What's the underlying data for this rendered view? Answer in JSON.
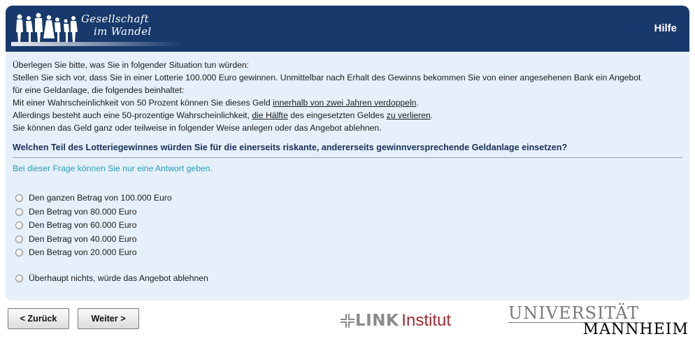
{
  "header": {
    "logo_line1": "Gesellschaft",
    "logo_line2": "im Wandel",
    "help_label": "Hilfe"
  },
  "intro": {
    "line1": "Überlegen Sie bitte, was Sie in folgender Situation tun würden:",
    "line2": "Stellen Sie sich vor, dass Sie in einer Lotterie 100.000 Euro gewinnen. Unmittelbar nach Erhalt des Gewinns bekommen Sie von einer angesehenen Bank ein Angebot",
    "line3": "für eine Geldanlage, die folgendes beinhaltet:",
    "line4_a": "Mit einer Wahrscheinlichkeit von 50 Prozent können Sie dieses Geld ",
    "line4_u": "innerhalb von zwei Jahren verdoppeln",
    "line4_b": ".",
    "line5_a": "Allerdings besteht auch eine 50-prozentige Wahrscheinlichkeit, ",
    "line5_u1": "die Hälfte",
    "line5_b": " des eingesetzten Geldes ",
    "line5_u2": "zu verlieren",
    "line5_c": ".",
    "line6": "Sie können das Geld ganz oder teilweise in folgender Weise anlegen oder das Angebot ablehnen."
  },
  "question": "Welchen Teil des Lotteriegewinnes würden Sie für die einerseits riskante, andererseits gewinnversprechende Geldanlage einsetzen?",
  "hint": "Bei dieser Frage können Sie nur eine Antwort geben.",
  "options": [
    "Den ganzen Betrag von 100.000 Euro",
    "Den Betrag von 80.000 Euro",
    "Den Betrag von 60.000 Euro",
    "Den Betrag von 40.000 Euro",
    "Den Betrag von 20.000 Euro",
    "Überhaupt nichts, würde das Angebot ablehnen"
  ],
  "nav": {
    "back_label": "< Zurück",
    "next_label": "Weiter >"
  },
  "footer": {
    "link_bold": "LINK",
    "link_light": "Institut",
    "uni_line1": "UNIVERSITÄT",
    "uni_line2": "MANNHEIM"
  },
  "colors": {
    "header_bg": "#17396b",
    "panel_bg": "#e5f0fa",
    "hint": "#2a9bb5",
    "question": "#1b2f5b",
    "link_red": "#a12a33"
  }
}
